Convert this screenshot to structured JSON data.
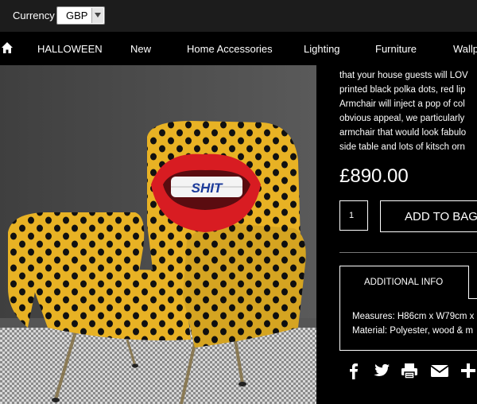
{
  "currency": {
    "label": "Currency",
    "selected": "GBP"
  },
  "nav": {
    "home_icon": "home-icon",
    "items": [
      "HALLOWEEN",
      "New",
      "Home Accessories",
      "Lighting",
      "Furniture",
      "Wallp"
    ]
  },
  "product": {
    "description_lines": [
      "that your house guests will LOV",
      "printed black polka dots, red lip",
      "Armchair will inject a pop of col",
      "obvious appeal, we particularly",
      "armchair that would look fabulo",
      "side table and lots of kitsch orn"
    ],
    "lips_text": "SHIT",
    "price": "£890.00",
    "quantity": "1",
    "add_to_bag": "ADD TO BAG",
    "tab_label": "ADDITIONAL INFO",
    "measures": "Measures: H86cm x W79cm x",
    "material": "Material: Polyester, wood & m"
  },
  "social_icons": [
    "facebook-icon",
    "twitter-icon",
    "print-icon",
    "email-icon",
    "plus-icon"
  ],
  "colors": {
    "topbar": "#1c1c1c",
    "nav": "#000000",
    "chair": "#e8b224",
    "lips": "#d81c22"
  }
}
